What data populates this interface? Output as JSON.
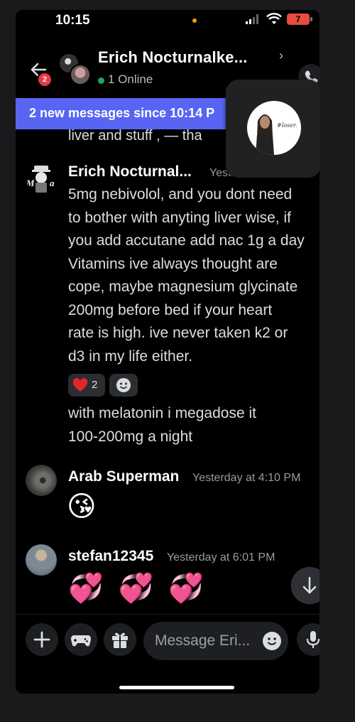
{
  "status_bar": {
    "time": "10:15",
    "battery": "7"
  },
  "header": {
    "back_badge": "2",
    "title": "Erich Nocturnalke...",
    "chevron": "›",
    "online": "1 Online"
  },
  "banner": {
    "text": "2 new messages since 10:14 P"
  },
  "pip": {
    "caption": "#loser."
  },
  "cut_text": "liver and stuff , — tha",
  "messages": [
    {
      "author": "Erich Nocturnal...",
      "timestamp": "Yeste",
      "lines": [
        "5mg nebivolol, and you dont need",
        "to bother with anyting liver wise, if",
        "you add accutane add nac 1g a day",
        "Vitamins ive always thought are",
        "cope, maybe magnesium glycinate",
        "200mg before bed if your heart",
        "rate is high. ive never taken k2 or",
        "d3 in my life either."
      ],
      "reaction_count": "2",
      "followup_lines": [
        "with melatonin i megadose it",
        "100-200mg a night"
      ]
    },
    {
      "author": "Arab Superman",
      "timestamp": "Yesterday at 4:10 PM",
      "emoji": "😘"
    },
    {
      "author": "stefan12345",
      "timestamp": "Yesterday at 6:01 PM",
      "emoji": "💞 💞 💞"
    }
  ],
  "composer": {
    "placeholder": "Message Eri..."
  },
  "icons": {
    "back": "arrow-left-icon",
    "call": "phone-icon",
    "reaction": "heart-icon",
    "add_reaction": "smiley-plus-icon",
    "jump": "arrow-down-icon",
    "plus": "plus-icon",
    "games": "gamepad-icon",
    "gift": "gift-icon",
    "emoji": "smiley-icon",
    "mic": "microphone-icon"
  },
  "colors": {
    "accent": "#5865f2",
    "online": "#23a55a",
    "badge": "#e63946",
    "heart": "#e3262e"
  }
}
